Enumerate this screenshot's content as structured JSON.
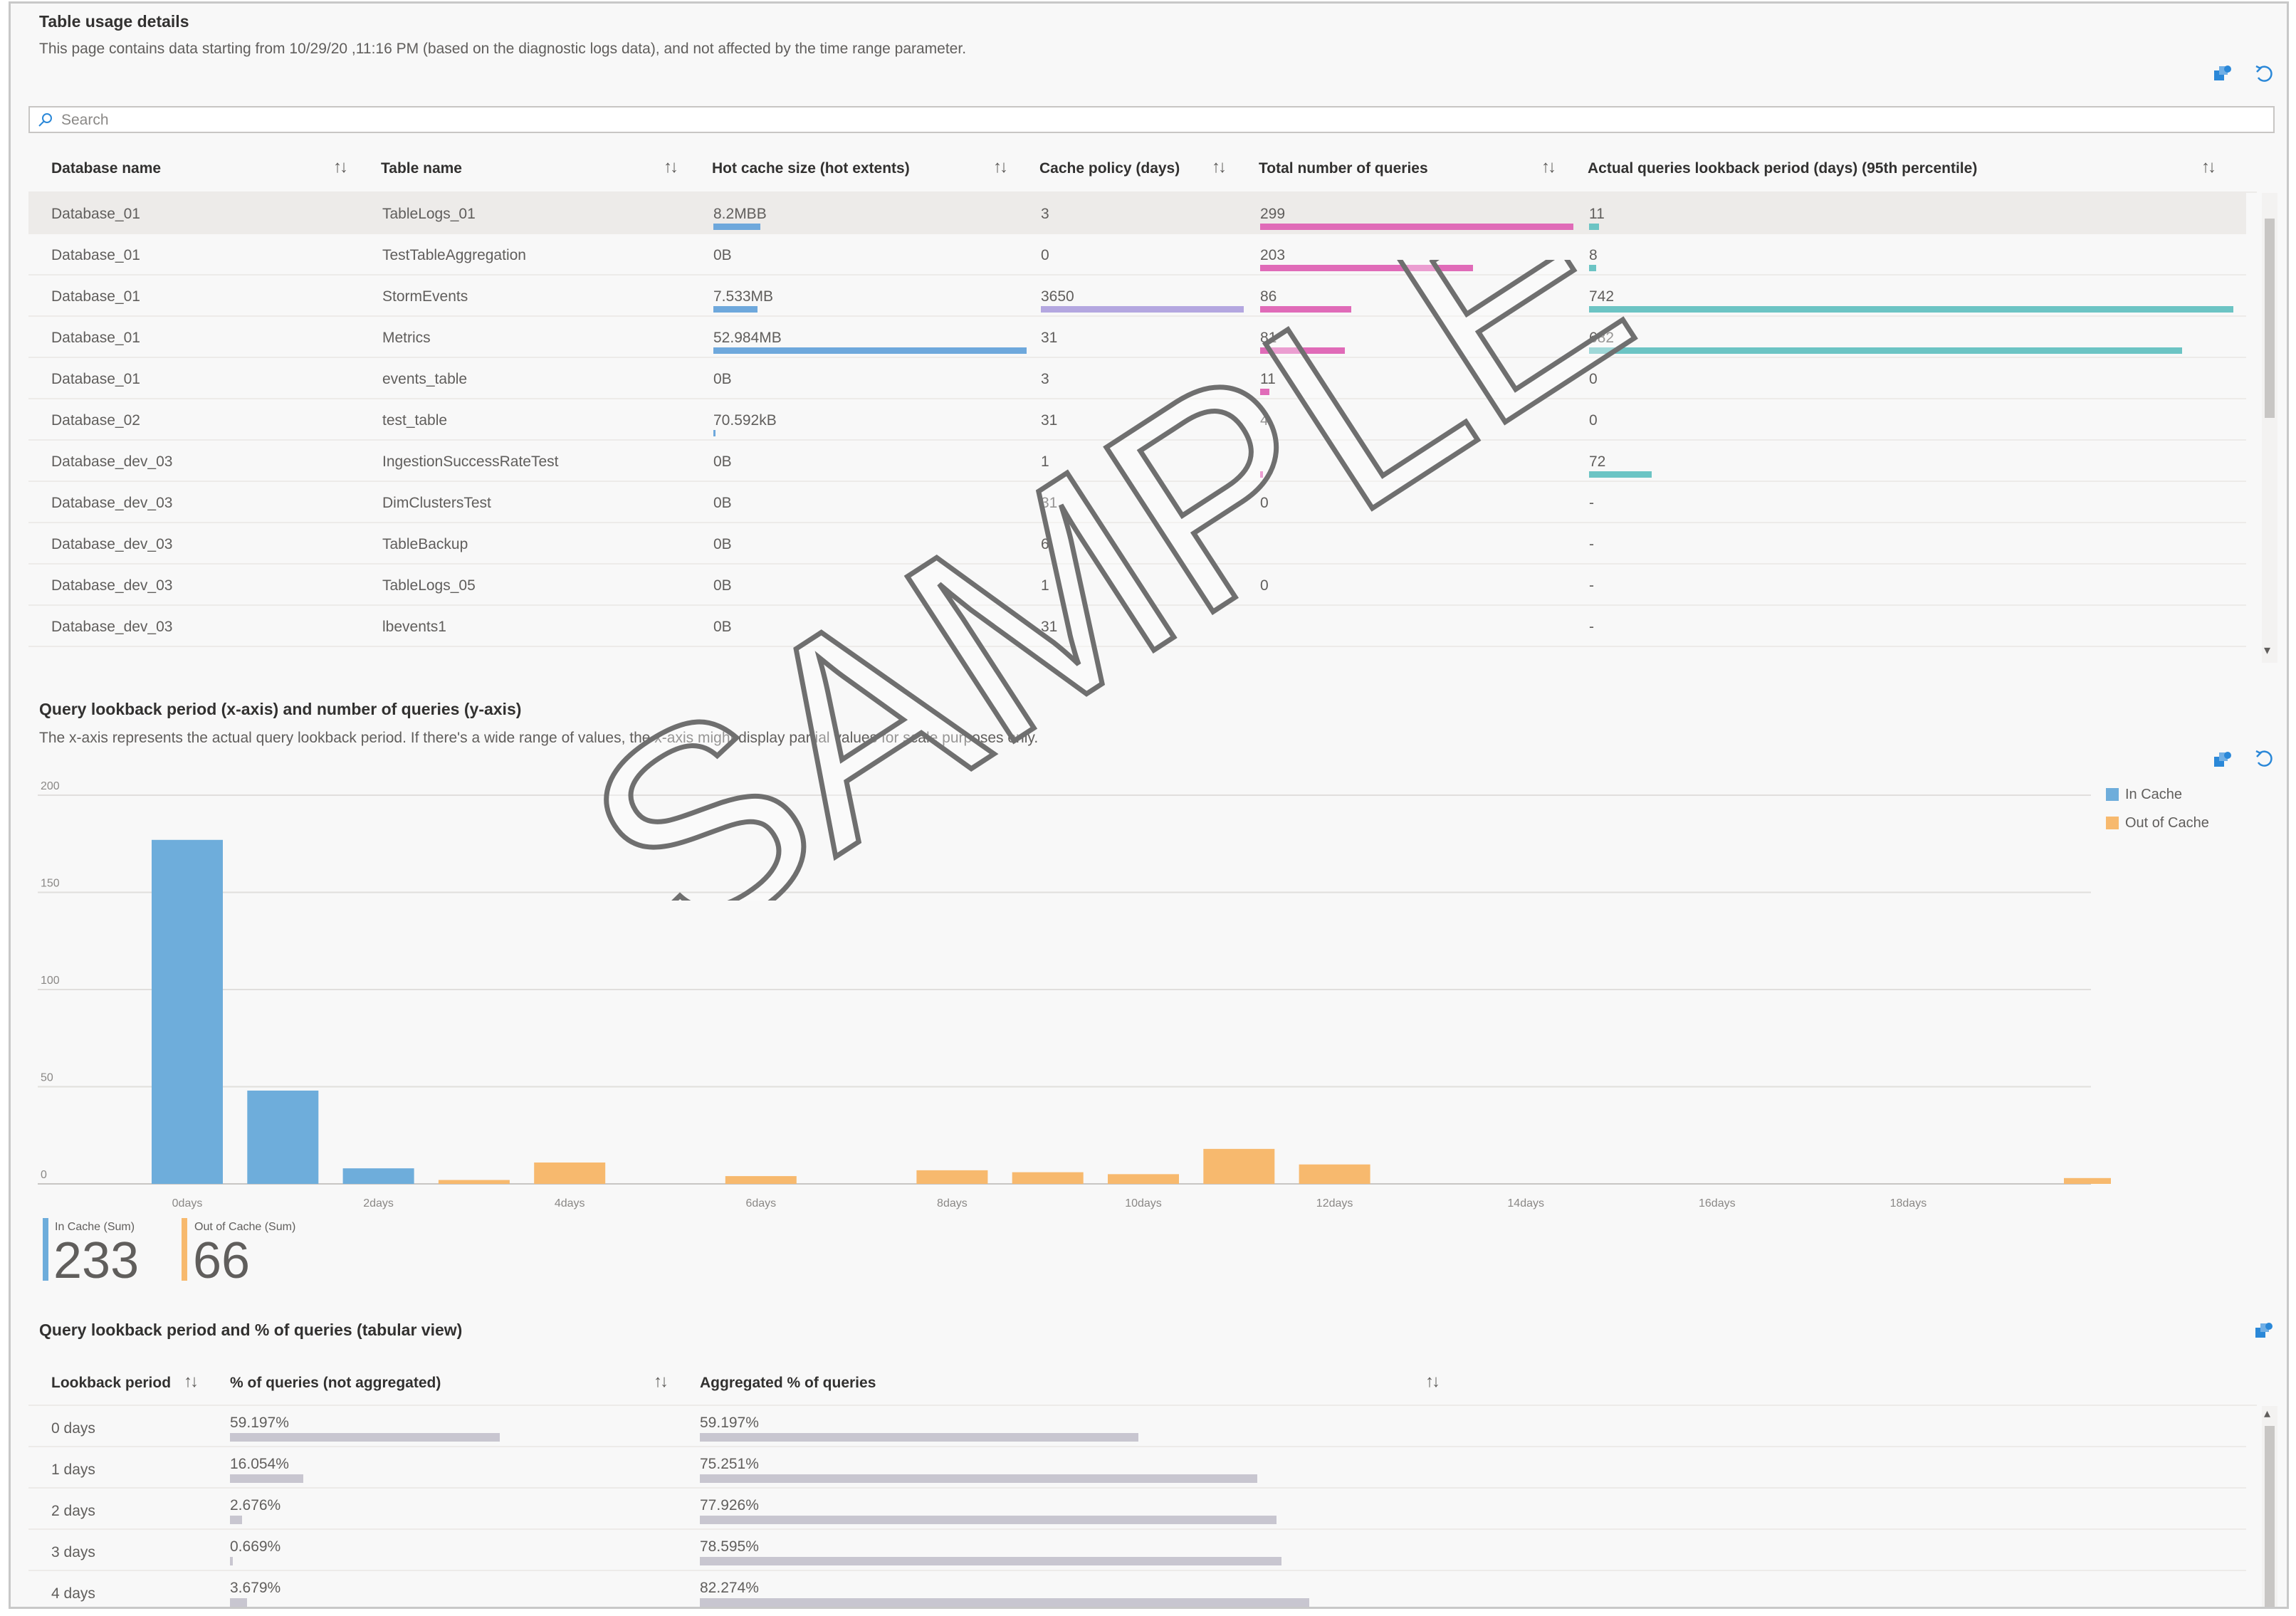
{
  "usage": {
    "title": "Table usage details",
    "subtitle": "This page contains data starting from 10/29/20 ,11:16 PM (based on the diagnostic logs data), and not affected by the time range parameter.",
    "search_placeholder": "Search",
    "columns": [
      "Database name",
      "Table name",
      "Hot cache size (hot extents)",
      "Cache policy (days)",
      "Total number of queries",
      "Actual queries lookback period (days) (95th percentile)"
    ],
    "rows": [
      {
        "db": "Database_01",
        "table": "TableLogs_01",
        "hot": "8.2MBB",
        "policy": "3",
        "queries": "299",
        "lookback": "11"
      },
      {
        "db": "Database_01",
        "table": "TestTableAggregation",
        "hot": "0B",
        "policy": "0",
        "queries": "203",
        "lookback": "8"
      },
      {
        "db": "Database_01",
        "table": "StormEvents",
        "hot": "7.533MB",
        "policy": "3650",
        "queries": "86",
        "lookback": "742"
      },
      {
        "db": "Database_01",
        "table": "Metrics",
        "hot": "52.984MB",
        "policy": "31",
        "queries": "81",
        "lookback": "682"
      },
      {
        "db": "Database_01",
        "table": "events_table",
        "hot": "0B",
        "policy": "3",
        "queries": "11",
        "lookback": "0"
      },
      {
        "db": "Database_02",
        "table": "test_table",
        "hot": "70.592kB",
        "policy": "31",
        "queries": "4",
        "lookback": "0"
      },
      {
        "db": "Database_dev_03",
        "table": "IngestionSuccessRateTest",
        "hot": "0B",
        "policy": "1",
        "queries": "",
        "lookback": "72"
      },
      {
        "db": "Database_dev_03",
        "table": "DimClustersTest",
        "hot": "0B",
        "policy": "31",
        "queries": "0",
        "lookback": "-"
      },
      {
        "db": "Database_dev_03",
        "table": "TableBackup",
        "hot": "0B",
        "policy": "6",
        "queries": "",
        "lookback": "-"
      },
      {
        "db": "Database_dev_03",
        "table": "TableLogs_05",
        "hot": "0B",
        "policy": "1",
        "queries": "0",
        "lookback": "-"
      },
      {
        "db": "Database_dev_03",
        "table": "lbevents1",
        "hot": "0B",
        "policy": "31",
        "queries": "",
        "lookback": "-"
      }
    ],
    "bar_fraction": {
      "hot": [
        0.15,
        0,
        0.14,
        1.0,
        0,
        0.005,
        0,
        0,
        0,
        0,
        0
      ],
      "policy": [
        0,
        0,
        1.0,
        0,
        0,
        0,
        0,
        0,
        0,
        0,
        0
      ],
      "queries": [
        1.0,
        0.68,
        0.29,
        0.27,
        0.03,
        0,
        0.01,
        0,
        0,
        0,
        0
      ],
      "lookback": [
        0.015,
        0.011,
        1.0,
        0.92,
        0,
        0,
        0.097,
        0,
        0,
        0,
        0
      ]
    },
    "colors": {
      "hot": "#6ea8dc",
      "policy": "#b4a7e0",
      "queries": "#e06bb8",
      "lookback": "#6cc4c4"
    }
  },
  "chart_section": {
    "title": "Query lookback period (x-axis) and number of queries (y-axis)",
    "subtitle": "The x-axis represents the actual query lookback period. If there's a wide range of values, the x-axis might display partial values for scale purposes only."
  },
  "chart_data": {
    "type": "bar",
    "x": [
      0,
      1,
      2,
      3,
      4,
      5,
      6,
      7,
      8,
      9,
      10,
      11,
      12,
      13,
      14,
      15,
      16,
      17,
      18,
      19,
      20
    ],
    "x_tick_labels": [
      "0days",
      "2days",
      "4days",
      "6days",
      "8days",
      "10days",
      "12days",
      "14days",
      "16days",
      "18days"
    ],
    "x_tick_values": [
      0,
      2,
      4,
      6,
      8,
      10,
      12,
      14,
      16,
      18
    ],
    "y_ticks": [
      0,
      50,
      100,
      150,
      200
    ],
    "ylim": [
      0,
      200
    ],
    "series": [
      {
        "name": "In Cache",
        "color": "#6eaddb",
        "values": [
          177,
          48,
          8,
          0,
          0,
          0,
          0,
          0,
          0,
          0,
          0,
          0,
          0,
          0,
          0,
          0,
          0,
          0,
          0,
          0,
          0
        ]
      },
      {
        "name": "Out of Cache",
        "color": "#f7b96e",
        "values": [
          0,
          0,
          0,
          2,
          11,
          0,
          4,
          0,
          7,
          6,
          5,
          18,
          10,
          0,
          0,
          0,
          0,
          0,
          0,
          0,
          3
        ]
      }
    ],
    "legend_position": "top-right",
    "grid": true
  },
  "tiles": [
    {
      "label": "In Cache (Sum)",
      "value": "233",
      "color": "#6eaddb"
    },
    {
      "label": "Out of Cache (Sum)",
      "value": "66",
      "color": "#f7b96e"
    }
  ],
  "tabular": {
    "title": "Query lookback period and % of queries (tabular view)",
    "columns": [
      "Lookback period",
      "% of queries (not aggregated)",
      "Aggregated % of queries"
    ],
    "rows": [
      {
        "period": "0 days",
        "pct": "59.197%",
        "agg": "59.197%",
        "pct_v": 59.197,
        "agg_v": 59.197
      },
      {
        "period": "1 days",
        "pct": "16.054%",
        "agg": "75.251%",
        "pct_v": 16.054,
        "agg_v": 75.251
      },
      {
        "period": "2 days",
        "pct": "2.676%",
        "agg": "77.926%",
        "pct_v": 2.676,
        "agg_v": 77.926
      },
      {
        "period": "3 days",
        "pct": "0.669%",
        "agg": "78.595%",
        "pct_v": 0.669,
        "agg_v": 78.595
      },
      {
        "period": "4 days",
        "pct": "3.679%",
        "agg": "82.274%",
        "pct_v": 3.679,
        "agg_v": 82.274
      }
    ],
    "bar_color": "#c8c6d0"
  },
  "watermark": "SAMPLE",
  "icons": [
    "pin-icon",
    "undo-icon",
    "search-icon",
    "sort-icon",
    "scroll-down-icon"
  ]
}
